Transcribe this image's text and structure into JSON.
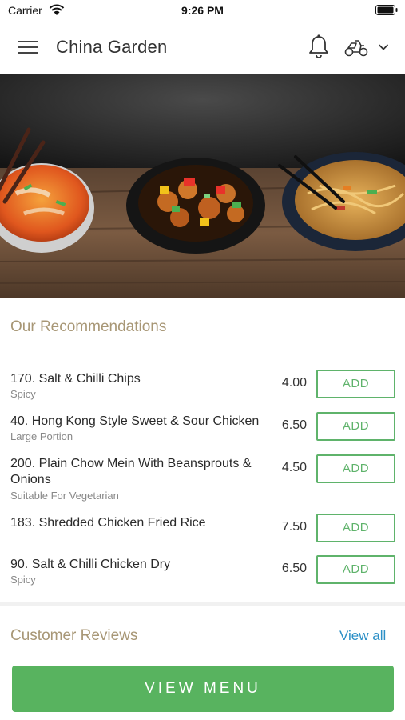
{
  "status_bar": {
    "carrier": "Carrier",
    "time": "9:26 PM"
  },
  "header": {
    "title": "China Garden"
  },
  "icons": {
    "menu": "hamburger-menu-icon",
    "notifications": "bell-icon",
    "delivery": "scooter-icon",
    "dropdown": "chevron-down-icon"
  },
  "recommendations": {
    "title": "Our Recommendations",
    "items": [
      {
        "name": "170. Salt & Chilli Chips",
        "note": "Spicy",
        "price": "4.00",
        "button": "ADD"
      },
      {
        "name": "40. Hong Kong Style Sweet & Sour Chicken",
        "note": "Large Portion",
        "price": "6.50",
        "button": "ADD"
      },
      {
        "name": "200. Plain Chow Mein With Beansprouts & Onions",
        "note": "Suitable For Vegetarian",
        "price": "4.50",
        "button": "ADD"
      },
      {
        "name": "183. Shredded Chicken Fried Rice",
        "note": "",
        "price": "7.50",
        "button": "ADD"
      },
      {
        "name": "90. Salt & Chilli Chicken Dry",
        "note": "Spicy",
        "price": "6.50",
        "button": "ADD"
      }
    ]
  },
  "reviews": {
    "title": "Customer Reviews",
    "view_all": "View all"
  },
  "footer": {
    "view_menu": "VIEW MENU"
  },
  "colors": {
    "accent_green": "#58b35f",
    "section_title": "#a89776",
    "link_blue": "#2b8fc6"
  }
}
